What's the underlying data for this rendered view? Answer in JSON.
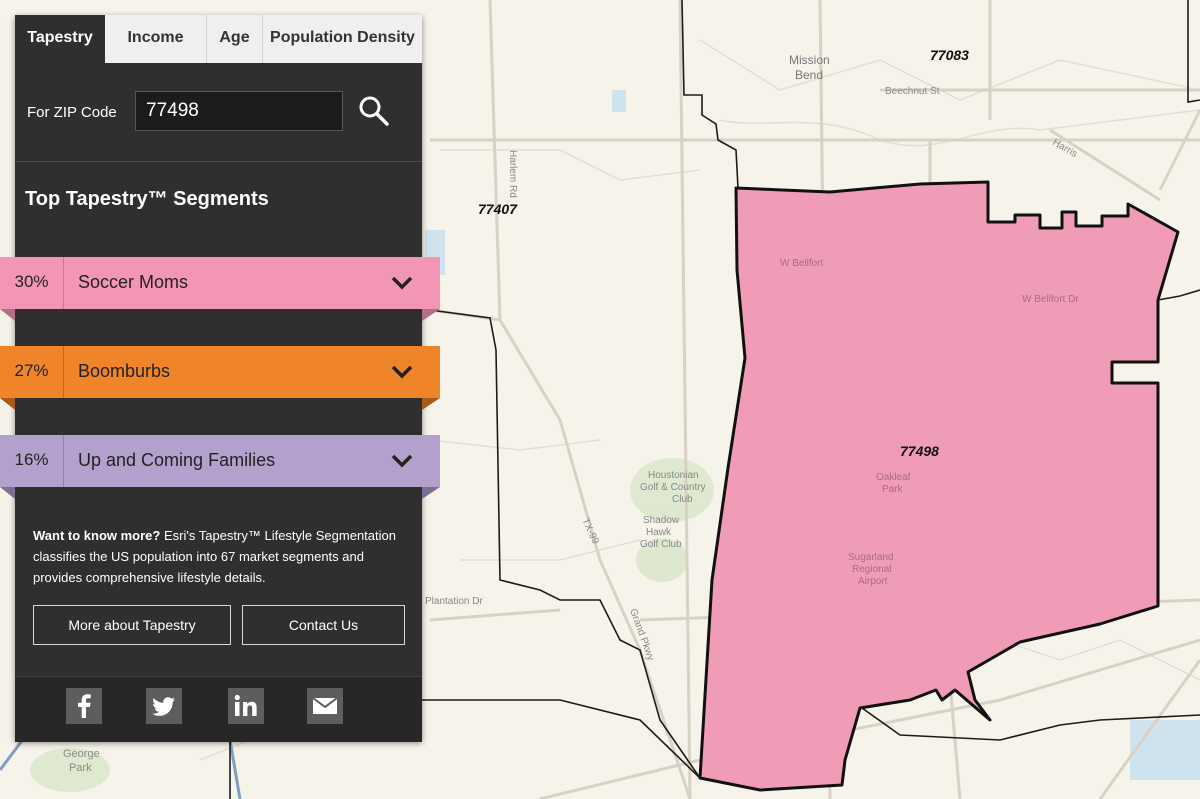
{
  "tabs": [
    {
      "label": "Tapestry",
      "active": true
    },
    {
      "label": "Income",
      "active": false
    },
    {
      "label": "Age",
      "active": false
    },
    {
      "label": "Population Density",
      "active": false
    }
  ],
  "zip": {
    "label": "For ZIP Code",
    "value": "77498"
  },
  "segments_title": "Top Tapestry™ Segments",
  "segments": [
    {
      "pct": "30%",
      "name": "Soccer Moms",
      "color": "#f396b6",
      "fold_color": "#b06f86"
    },
    {
      "pct": "27%",
      "name": "Boomburbs",
      "color": "#f08428",
      "fold_color": "#a9591a"
    },
    {
      "pct": "16%",
      "name": "Up and Coming Families",
      "color": "#b4a0cc",
      "fold_color": "#7d6e92"
    }
  ],
  "info": {
    "bold": "Want to know more?",
    "text": " Esri's Tapestry™ Lifestyle Segmentation classifies the US population into 67 market segments and provides comprehensive lifestyle details."
  },
  "buttons": {
    "more": "More about Tapestry",
    "contact": "Contact Us"
  },
  "social": [
    "facebook-icon",
    "twitter-icon",
    "linkedin-icon",
    "email-icon"
  ],
  "map": {
    "highlight_color": "#f19cb6",
    "zip_labels": [
      "77083",
      "77407",
      "77498"
    ],
    "place_labels": [
      "Mission",
      "Bend",
      "George",
      "Park",
      "Houstonian",
      "Golf & Country",
      "Club",
      "Shadow",
      "Hawk",
      "Golf Club",
      "Sugarland",
      "Regional",
      "Airport",
      "Oakleaf",
      "Park"
    ],
    "road_labels": [
      "Beechnut St",
      "W Bellfort",
      "W Bellfort Dr",
      "Plantation Dr",
      "Harlem Rd",
      "TX-99",
      "Grand Pkwy",
      "Harris"
    ]
  }
}
